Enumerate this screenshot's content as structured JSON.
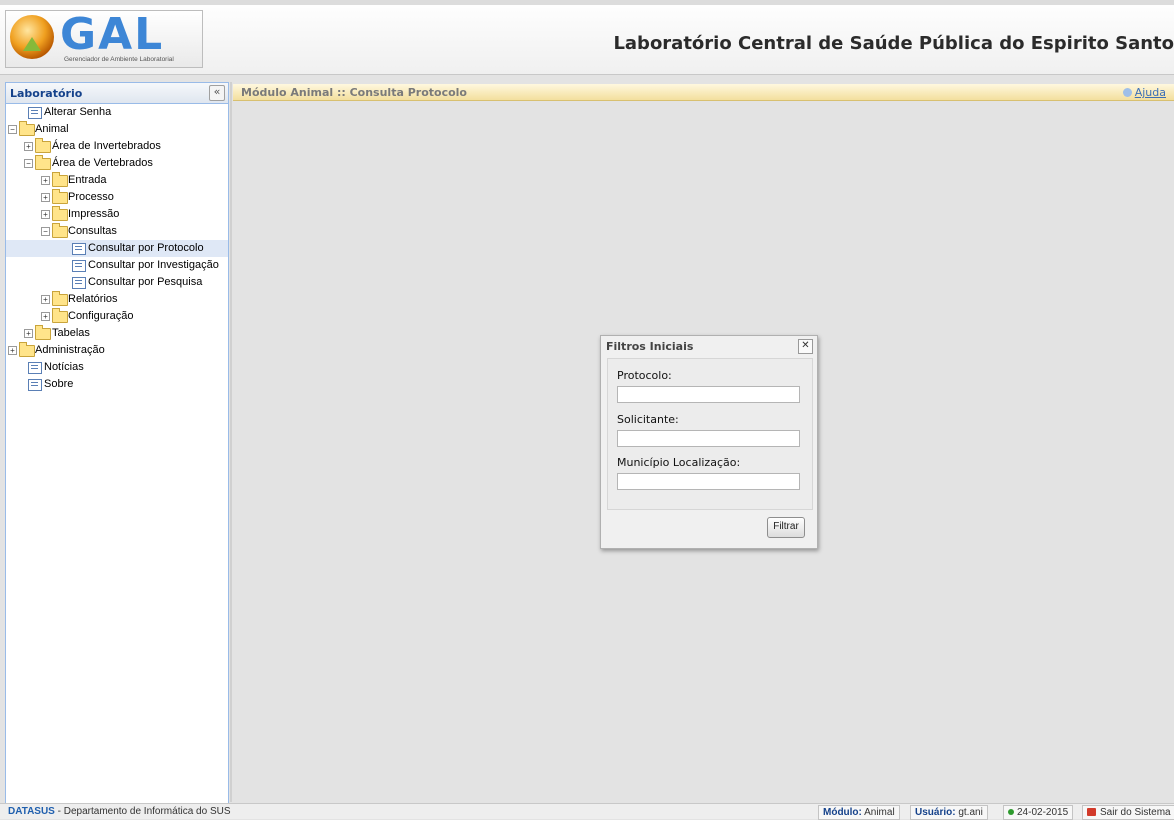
{
  "header": {
    "logo_text": "GAL",
    "logo_subtitle": "Gerenciador de Ambiente Laboratorial",
    "title": "Laboratório Central de Saúde Pública do Espirito Santo"
  },
  "sidebar": {
    "title": "Laboratório",
    "collapse_glyph": "«",
    "items": [
      {
        "label": "Alterar Senha"
      },
      {
        "label": "Animal"
      },
      {
        "label": "Área de Invertebrados"
      },
      {
        "label": "Área de Vertebrados"
      },
      {
        "label": "Entrada"
      },
      {
        "label": "Processo"
      },
      {
        "label": "Impressão"
      },
      {
        "label": "Consultas"
      },
      {
        "label": "Consultar por Protocolo"
      },
      {
        "label": "Consultar por Investigação"
      },
      {
        "label": "Consultar por Pesquisa"
      },
      {
        "label": "Relatórios"
      },
      {
        "label": "Configuração"
      },
      {
        "label": "Tabelas"
      },
      {
        "label": "Administração"
      },
      {
        "label": "Notícias"
      },
      {
        "label": "Sobre"
      }
    ]
  },
  "main": {
    "title": "Módulo Animal :: Consulta Protocolo",
    "help_label": "Ajuda"
  },
  "dialog": {
    "title": "Filtros Iniciais",
    "close_glyph": "✕",
    "fields": [
      {
        "label": "Protocolo:",
        "value": ""
      },
      {
        "label": "Solicitante:",
        "value": ""
      },
      {
        "label": "Município Localização:",
        "value": ""
      }
    ],
    "filter_button": "Filtrar"
  },
  "footer": {
    "org_abbr": "DATASUS",
    "org_rest": " - Departamento de Informática do SUS",
    "module_label": "Módulo:",
    "module_value": " Animal",
    "user_label": "Usuário:",
    "user_value": " gt.ani",
    "date": "24-02-2015",
    "exit_label": "Sair do Sistema"
  }
}
